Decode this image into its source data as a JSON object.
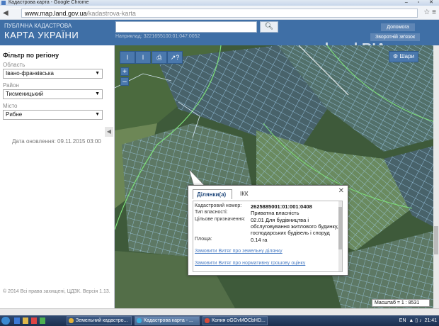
{
  "browser": {
    "window_title": "Кадастрова карта - Google Chrome",
    "url_host": "www.map.land.gov.ua",
    "url_path": "/kadastrova-karta",
    "window_controls": "– ▫ ✕"
  },
  "header": {
    "logo_line1": "ПУБЛІЧНА КАДАСТРОВА",
    "logo_line2": "КАРТА УКРАЇНИ",
    "search_value": "",
    "search_hint": "Наприклад: 3221655100:01:047:0052",
    "help_label": "Допомога",
    "feedback_label": "Зворотній зв'язок",
    "watermark": "dom | RIA"
  },
  "sidebar": {
    "title": "Фільтр по регіону",
    "oblast_label": "Область",
    "oblast_value": "Івано-франківська",
    "rayon_label": "Район",
    "rayon_value": "Тисменицький",
    "misto_label": "Місто",
    "misto_value": "Рибне",
    "updated": "Дата оновлення: 09.11.2015 03:00",
    "copyright": "© 2014 Всі права захищені, ЦДЗК. Версія 1.13."
  },
  "map": {
    "tool_labels": [
      "I",
      "I",
      "⎙",
      "↗?"
    ],
    "zoom_in": "+",
    "zoom_out": "–",
    "layers_label": "Шари",
    "scale_text": "Масштаб = 1 : 8531"
  },
  "popup": {
    "tab_active": "Ділянки(а)",
    "tab_inactive": "ІКК",
    "close": "✕",
    "rows": [
      {
        "label": "Кадастровий номер:",
        "value": "2625885001:01:001:0408"
      },
      {
        "label": "Тип власності:",
        "value": "Приватна власність"
      },
      {
        "label": "Цільове призначення:",
        "value": "02.01 Для будівництва і обслуговування житлового будинку, господарських будівель і споруд"
      },
      {
        "label": "Площа:",
        "value": "0.14 га"
      }
    ],
    "link1": "Замовити Витяг про земельну ділянку",
    "link2": "Замовити Витяг про нормативну грошову оцінку"
  },
  "taskbar": {
    "items": [
      {
        "label": "Земельний кадастро...",
        "color": "#e2b23a"
      },
      {
        "label": "Кадастрова карта - ...",
        "color": "#3bb0e0"
      },
      {
        "label": "Копия oGGvMOCbHD...",
        "color": "#d64a3a"
      }
    ],
    "lang": "EN",
    "time": "21:41"
  },
  "colors": {
    "header_bg": "#3f6fa6",
    "button_bg": "#4a78ad",
    "parcel_line": "#9fd0f2",
    "boundary_line": "#7ee07a"
  }
}
